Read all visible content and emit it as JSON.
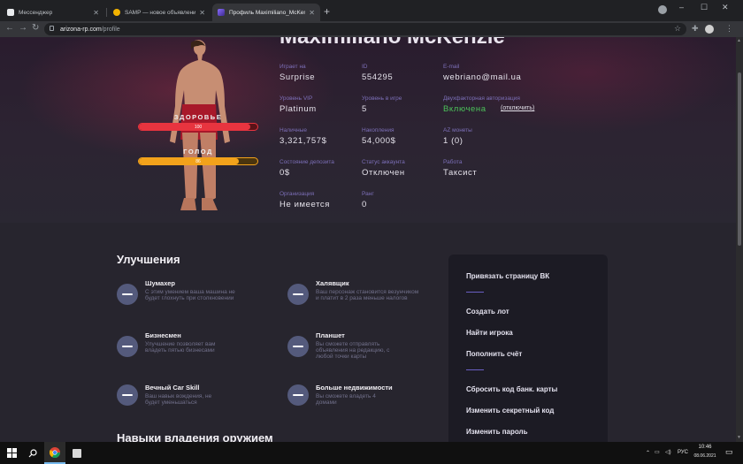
{
  "browser": {
    "tabs": [
      {
        "title": "Мессенджер",
        "active": false
      },
      {
        "title": "SAMP — новое объявление",
        "active": false
      },
      {
        "title": "Профиль Maximiliano_McKenzie",
        "active": true
      }
    ],
    "url_host": "arizona-rp.com",
    "url_path": "/profile"
  },
  "profile": {
    "name": "Maximiliano McKenzie",
    "health": {
      "label": "ЗДОРОВЬЕ",
      "value": "100",
      "fraction": 0.94,
      "color": "#e8343f"
    },
    "hunger": {
      "label": "ГОЛОД",
      "value": "86",
      "fraction": 0.84,
      "color": "#f2a21b"
    },
    "fields": [
      {
        "label": "Играет на",
        "value": "Surprise"
      },
      {
        "label": "ID",
        "value": "554295"
      },
      {
        "label": "E-mail",
        "value": "webriano@mail.ua"
      },
      {
        "label": "Уровень VIP",
        "value": "Platinum"
      },
      {
        "label": "Уровень в игре",
        "value": "5"
      },
      {
        "label": "Двухфакторная авторизация",
        "value": "Включена",
        "link": "(отключить)"
      },
      {
        "label": "Наличные",
        "value": "3,321,757$"
      },
      {
        "label": "Накопления",
        "value": "54,000$"
      },
      {
        "label": "AZ монеты",
        "value": "1 (0)"
      },
      {
        "label": "Состояние депозита",
        "value": "0$"
      },
      {
        "label": "Статус аккаунта",
        "value": "Отключен"
      },
      {
        "label": "Работа",
        "value": "Таксист"
      },
      {
        "label": "Организация",
        "value": "Не имеется"
      },
      {
        "label": "Ранг",
        "value": "0"
      }
    ]
  },
  "upgrades": {
    "title": "Улучшения",
    "items": [
      {
        "name": "Шумахер",
        "desc": "С этим умением ваша машина не будет глохнуть при столкновении"
      },
      {
        "name": "Халявщик",
        "desc": "Ваш персонаж становится везунчиком и платит в 2 раза меньше налогов"
      },
      {
        "name": "Бизнесмен",
        "desc": "Улучшение позволяет вам владеть пятью бизнесами"
      },
      {
        "name": "Планшет",
        "desc": "Вы сможете отправлять объявления на редакцию, с любой точки карты"
      },
      {
        "name": "Вечный Car Skill",
        "desc": "Ваш навык вождения, не будет уменьшаться"
      },
      {
        "name": "Больше недвижимости",
        "desc": "Вы сможете владеть 4 домами"
      }
    ]
  },
  "weapons_title": "Навыки владения оружием",
  "menu": [
    "Привязать страницу ВК",
    "Создать лот",
    "Найти игрока",
    "Пополнить счёт",
    "Сбросить код банк. карты",
    "Изменить секретный код",
    "Изменить пароль"
  ],
  "taskbar": {
    "time": "10:46",
    "date": "08.06.2021",
    "lang": "РУС"
  }
}
